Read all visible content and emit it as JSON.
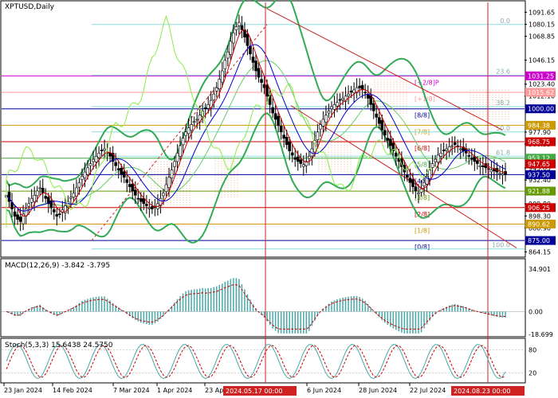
{
  "title": "XPTUSD,Daily",
  "macd_label": "MACD(12,26,9) -3.842 -3.795",
  "stoch_label": "Stoch(5,3,3) 15.6438 24.5750",
  "chart_data": [
    {
      "type": "candlestick",
      "symbol": "XPTUSD",
      "timeframe": "Daily",
      "ylim": [
        860.0,
        1101.0
      ],
      "price_ticks": [
        "1091.65",
        "1080.15",
        "1068.85",
        "1046.15",
        "1023.40",
        "1012.10",
        "977.90",
        "966.55",
        "943.85",
        "932.40",
        "909.80",
        "898.30",
        "886.90",
        "864.15"
      ],
      "date_ticks": [
        "23 Jan 2024",
        "14 Feb 2024",
        "7 Mar 2024",
        "1 Apr 2024",
        "23 Apr 2024",
        "6 Jun 2024",
        "28 Jun 2024",
        "22 Jul 2024"
      ],
      "highlight_dates": [
        "2024.05.17 00:00",
        "2024.08.23 00:00"
      ],
      "current_price": 937.5,
      "price_tags": [
        {
          "value": 1031.25,
          "label": "1031.25",
          "color": "#cc00cc"
        },
        {
          "value": 1015.62,
          "label": "1015.62",
          "color": "#ff9999"
        },
        {
          "value": 1000.0,
          "label": "1000.00",
          "color": "#000099"
        },
        {
          "value": 984.38,
          "label": "984.38",
          "color": "#cc9900"
        },
        {
          "value": 968.75,
          "label": "968.75",
          "color": "#cc0000"
        },
        {
          "value": 953.12,
          "label": "953.12",
          "color": "#44aa44"
        },
        {
          "value": 947.65,
          "label": "947.65",
          "color": "#cc0000"
        },
        {
          "value": 937.5,
          "label": "937.50",
          "color": "#000099"
        },
        {
          "value": 921.88,
          "label": "921.88",
          "color": "#669900"
        },
        {
          "value": 906.25,
          "label": "906.25",
          "color": "#cc0000"
        },
        {
          "value": 890.62,
          "label": "890.62",
          "color": "#cc9900"
        },
        {
          "value": 875.0,
          "label": "875.00",
          "color": "#000099"
        }
      ],
      "murrey_levels": [
        {
          "value": 1031.25,
          "label": "[+2/8]P",
          "color": "#cc00cc"
        },
        {
          "value": 1015.62,
          "label": "[+1/8]",
          "color": "#ff9999"
        },
        {
          "value": 1000.0,
          "label": "[8/8]",
          "color": "#000099"
        },
        {
          "value": 984.38,
          "label": "[7/8]",
          "color": "#cc9900"
        },
        {
          "value": 968.75,
          "label": "[6/8]",
          "color": "#cc0000"
        },
        {
          "value": 953.12,
          "label": "[5/8]",
          "color": "#44aa44"
        },
        {
          "value": 937.5,
          "label": "[4/8]",
          "color": "#000099"
        },
        {
          "value": 921.88,
          "label": "[3/8]",
          "color": "#669900"
        },
        {
          "value": 906.25,
          "label": "[2/8]",
          "color": "#cc0000"
        },
        {
          "value": 890.62,
          "label": "[1/8]",
          "color": "#cc9900"
        },
        {
          "value": 875.0,
          "label": "[0/8]",
          "color": "#000099"
        }
      ],
      "fib_labels": [
        "0.0",
        "23.6",
        "38.2",
        "50.0",
        "61.8",
        "100.0"
      ],
      "series_close": [
        918,
        912,
        905,
        898,
        895,
        893,
        900,
        905,
        910,
        915,
        918,
        922,
        925,
        920,
        915,
        910,
        906,
        902,
        898,
        900,
        904,
        908,
        912,
        916,
        920,
        925,
        930,
        936,
        940,
        944,
        948,
        952,
        955,
        958,
        960,
        962,
        958,
        955,
        950,
        946,
        942,
        938,
        935,
        930,
        926,
        922,
        918,
        915,
        912,
        910,
        908,
        906,
        905,
        907,
        910,
        915,
        920,
        928,
        935,
        942,
        950,
        958,
        965,
        972,
        978,
        982,
        985,
        988,
        990,
        994,
        998,
        1000,
        1004,
        1008,
        1014,
        1020,
        1028,
        1036,
        1046,
        1054,
        1064,
        1072,
        1078,
        1082,
        1075,
        1068,
        1060,
        1052,
        1044,
        1036,
        1030,
        1025,
        1020,
        1012,
        1004,
        996,
        990,
        984,
        978,
        972,
        966,
        960,
        956,
        952,
        950,
        948,
        947,
        950,
        955,
        962,
        970,
        978,
        985,
        990,
        994,
        998,
        1002,
        1004,
        1006,
        1008,
        1010,
        1012,
        1014,
        1016,
        1018,
        1020,
        1020,
        1018,
        1015,
        1010,
        1004,
        998,
        992,
        986,
        980,
        975,
        970,
        965,
        960,
        955,
        950,
        945,
        940,
        935,
        930,
        926,
        922,
        920,
        924,
        930,
        936,
        942,
        948,
        952,
        956,
        958,
        960,
        962,
        964,
        965,
        966,
        964,
        962,
        960,
        958,
        955,
        952,
        950,
        948,
        946,
        945,
        944,
        943,
        942,
        941,
        940,
        939,
        938,
        937.5
      ],
      "macd_ylim": [
        -18.699,
        34.901
      ],
      "macd_ticks": [
        "34.901",
        "0.00",
        "-18.699"
      ],
      "stoch_ticks": [
        "80",
        "20"
      ]
    }
  ]
}
